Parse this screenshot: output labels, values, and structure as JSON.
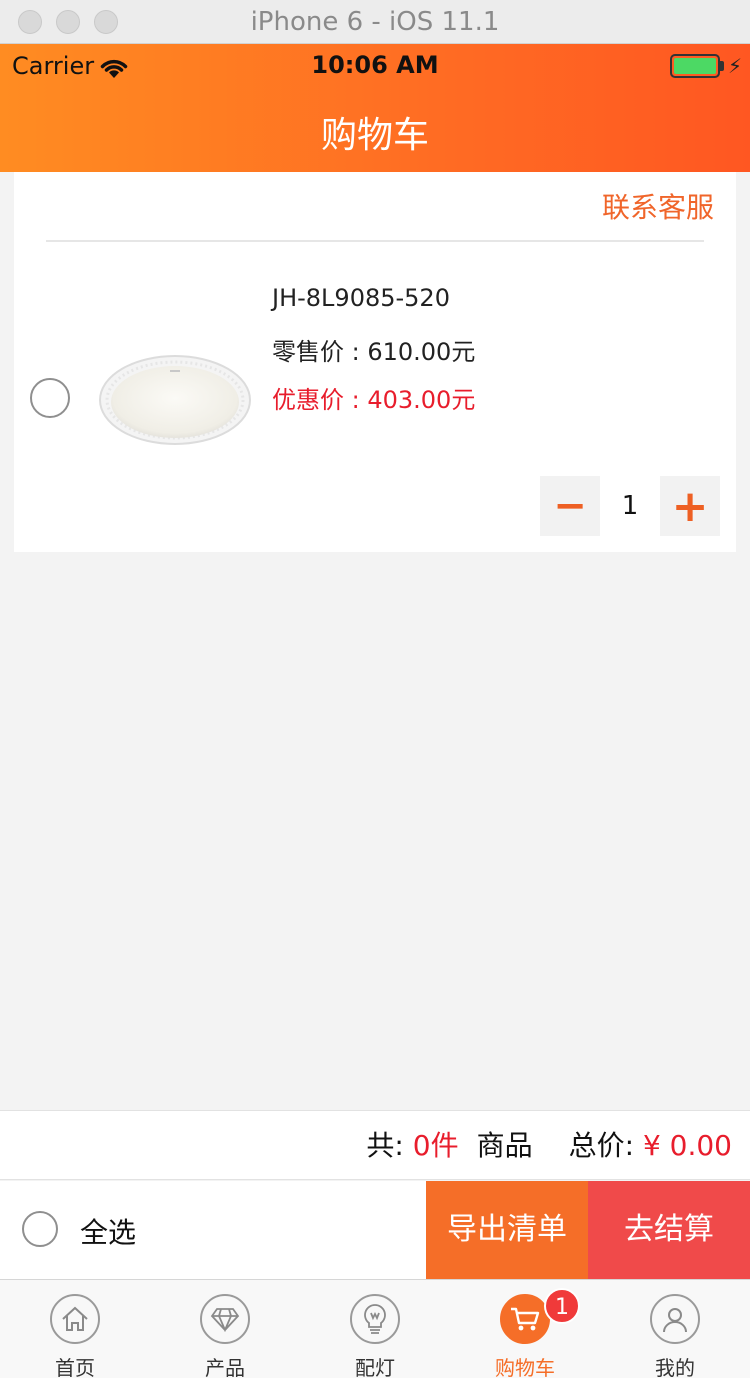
{
  "window": {
    "title": "iPhone 6 - iOS 11.1"
  },
  "status_bar": {
    "carrier": "Carrier",
    "time": "10:06 AM",
    "battery_level": 1.0
  },
  "header": {
    "title": "购物车"
  },
  "cart": {
    "contact_label": "联系客服",
    "items": [
      {
        "name": "JH-8L9085-520",
        "retail_price_text": "零售价 : 610.00元",
        "sale_price_text": "优惠价 : 403.00元",
        "quantity": "1",
        "minus_label": "−",
        "plus_label": "+"
      }
    ]
  },
  "summary": {
    "count_prefix": "共:",
    "count_value": "0件",
    "count_suffix": "商品",
    "total_label": "总价:",
    "total_value": "¥ 0.00"
  },
  "actions": {
    "select_all_label": "全选",
    "export_label": "导出清单",
    "checkout_label": "去结算"
  },
  "tabs": [
    {
      "label": "首页",
      "icon": "home-icon"
    },
    {
      "label": "产品",
      "icon": "diamond-icon"
    },
    {
      "label": "配灯",
      "icon": "lightbulb-icon"
    },
    {
      "label": "购物车",
      "icon": "cart-icon",
      "active": true,
      "badge": "1"
    },
    {
      "label": "我的",
      "icon": "user-icon"
    }
  ],
  "colors": {
    "accent": "#f56e28",
    "price_red": "#e81d2c",
    "checkout": "#f04a4a"
  }
}
